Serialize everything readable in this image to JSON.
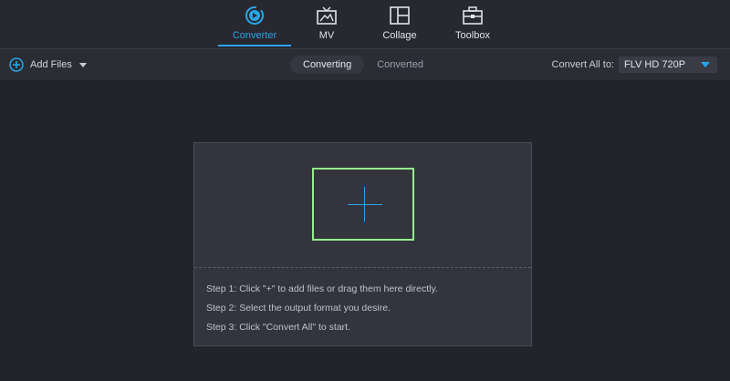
{
  "nav": {
    "items": [
      {
        "label": "Converter",
        "icon": "converter-icon",
        "active": true
      },
      {
        "label": "MV",
        "icon": "tv-icon",
        "active": false
      },
      {
        "label": "Collage",
        "icon": "collage-icon",
        "active": false
      },
      {
        "label": "Toolbox",
        "icon": "toolbox-icon",
        "active": false
      }
    ]
  },
  "toolbar": {
    "add_files_label": "Add Files",
    "tabs": [
      {
        "label": "Converting",
        "active": true
      },
      {
        "label": "Converted",
        "active": false
      }
    ],
    "convert_all_label": "Convert All to:",
    "format_value": "FLV HD 720P"
  },
  "drop": {
    "steps": [
      "Step 1: Click \"+\" to add files or drag them here directly.",
      "Step 2: Select the output format you desire.",
      "Step 3: Click \"Convert All\" to start."
    ]
  },
  "colors": {
    "accent": "#2aa4e8",
    "highlight_border": "#98ee8e",
    "background": "#23242b"
  }
}
